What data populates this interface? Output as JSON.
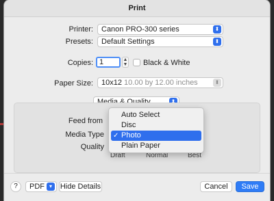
{
  "dialog": {
    "title": "Print"
  },
  "printer": {
    "label": "Printer:",
    "value": "Canon PRO-300 series"
  },
  "presets": {
    "label": "Presets:",
    "value": "Default Settings"
  },
  "copies": {
    "label": "Copies:",
    "value": "1",
    "bw_label": "Black & White"
  },
  "paper_size": {
    "label": "Paper Size:",
    "value": "10x12",
    "detail": "10.00 by 12.00 inches"
  },
  "section": {
    "value": "Media & Quality"
  },
  "feed": {
    "label": "Feed from"
  },
  "media_type": {
    "label": "Media Type"
  },
  "quality": {
    "label": "Quality",
    "ticks": [
      "Draft",
      "Normal",
      "Best"
    ]
  },
  "menu": {
    "items": [
      {
        "label": "Auto Select",
        "selected": false
      },
      {
        "label": "Disc",
        "selected": false
      },
      {
        "label": "Photo",
        "selected": true
      },
      {
        "label": "Plain Paper",
        "selected": false
      }
    ],
    "check_glyph": "✓"
  },
  "footer": {
    "help": "?",
    "pdf": "PDF",
    "hide_details": "Hide Details",
    "cancel": "Cancel",
    "save": "Save"
  }
}
